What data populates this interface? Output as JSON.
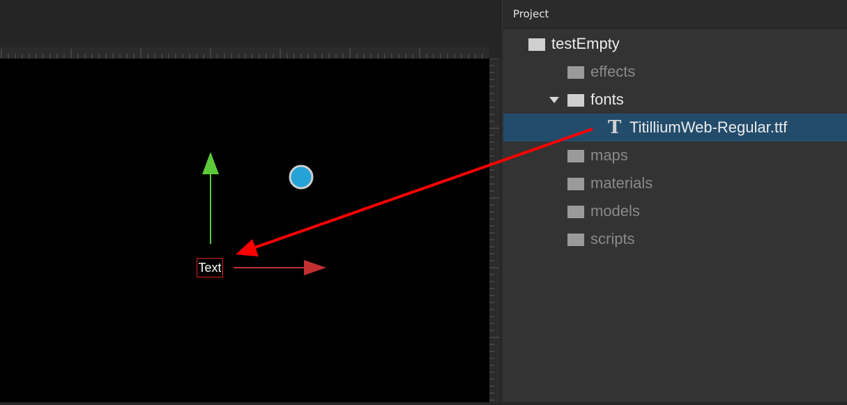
{
  "project_panel": {
    "title": "Project",
    "tree": [
      {
        "label": "testEmpty",
        "level": 0,
        "type": "folder",
        "state": "normal"
      },
      {
        "label": "effects",
        "level": 1,
        "type": "folder",
        "state": "dimmed"
      },
      {
        "label": "fonts",
        "level": 1,
        "type": "folder",
        "state": "expanded"
      },
      {
        "label": "TitilliumWeb-Regular.ttf",
        "level": 2,
        "type": "font-file",
        "state": "selected",
        "icon": "T"
      },
      {
        "label": "maps",
        "level": 1,
        "type": "folder",
        "state": "dimmed"
      },
      {
        "label": "materials",
        "level": 1,
        "type": "folder",
        "state": "dimmed"
      },
      {
        "label": "models",
        "level": 1,
        "type": "folder",
        "state": "dimmed"
      },
      {
        "label": "scripts",
        "level": 1,
        "type": "folder",
        "state": "dimmed"
      }
    ]
  },
  "viewport": {
    "entity_label": "Text"
  },
  "colors": {
    "selection": "#234c6b",
    "gizmo_y": "#5cc93a",
    "gizmo_x": "#c23030",
    "annotation_arrow": "#ff0000",
    "light_gizmo": "#26a3d6"
  }
}
